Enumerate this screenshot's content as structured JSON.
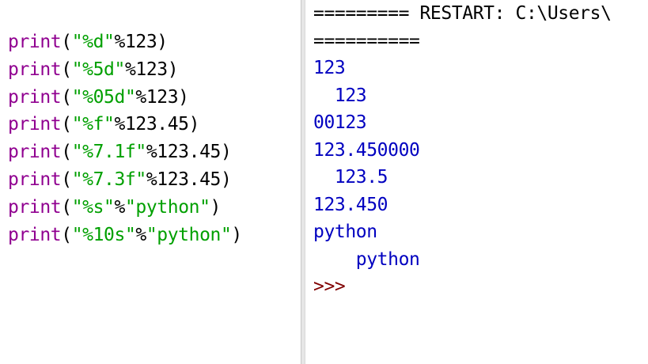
{
  "editor": {
    "lines": [
      {
        "kw": "print",
        "open": "(",
        "str": "\"%d\"",
        "rest": "%123)"
      },
      {
        "kw": "print",
        "open": "(",
        "str": "\"%5d\"",
        "rest": "%123)"
      },
      {
        "kw": "print",
        "open": "(",
        "str": "\"%05d\"",
        "rest": "%123)"
      },
      {
        "kw": "print",
        "open": "(",
        "str": "\"%f\"",
        "rest": "%123.45)"
      },
      {
        "kw": "print",
        "open": "(",
        "str": "\"%7.1f\"",
        "rest": "%123.45)"
      },
      {
        "kw": "print",
        "open": "(",
        "str": "\"%7.3f\"",
        "rest": "%123.45)"
      },
      {
        "kw": "print",
        "open": "(",
        "str": "\"%s\"",
        "rest": "%",
        "str2": "\"python\"",
        "close": ")"
      },
      {
        "kw": "print",
        "open": "(",
        "str": "\"%10s\"",
        "rest": "%",
        "str2": "\"python\"",
        "close": ")"
      }
    ]
  },
  "shell": {
    "restart_line": "========= RESTART: C:\\Users\\",
    "restart_cont": "==========",
    "outputs": [
      "123",
      "  123",
      "00123",
      "123.450000",
      "  123.5",
      "123.450",
      "python",
      "    python"
    ],
    "prompt": ">>>"
  },
  "colors": {
    "keyword": "#900090",
    "string": "#00a000",
    "output": "#0000c0",
    "prompt": "#800000"
  }
}
